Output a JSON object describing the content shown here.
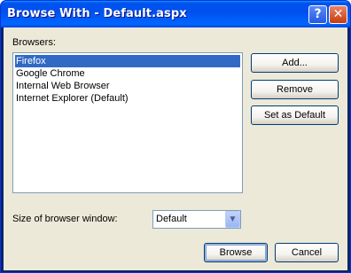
{
  "window": {
    "title": "Browse With - Default.aspx"
  },
  "titlebar": {
    "help_symbol": "?",
    "close_symbol": "✕"
  },
  "browsers": {
    "label": "Browsers:",
    "items": [
      "Firefox",
      "Google Chrome",
      "Internal Web Browser",
      "Internet Explorer (Default)"
    ],
    "selected": "Firefox"
  },
  "buttons": {
    "add": "Add...",
    "remove": "Remove",
    "set_default": "Set as Default",
    "browse": "Browse",
    "cancel": "Cancel"
  },
  "size": {
    "label": "Size of browser window:",
    "value": "Default"
  },
  "icons": {
    "dropdown": "chevron-down-icon"
  }
}
